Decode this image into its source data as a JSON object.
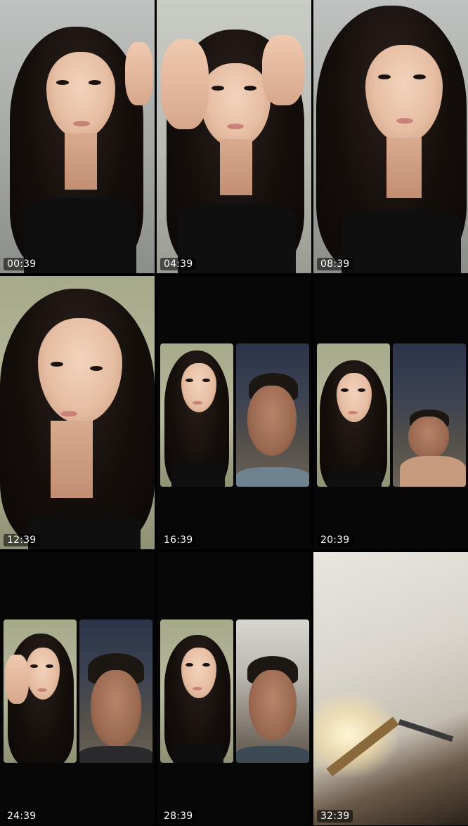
{
  "thumbnails": [
    {
      "timestamp": "00:39"
    },
    {
      "timestamp": "04:39"
    },
    {
      "timestamp": "08:39"
    },
    {
      "timestamp": "12:39"
    },
    {
      "timestamp": "16:39"
    },
    {
      "timestamp": "20:39"
    },
    {
      "timestamp": "24:39"
    },
    {
      "timestamp": "28:39"
    },
    {
      "timestamp": "32:39"
    }
  ],
  "colors": {
    "background": "#000000",
    "timestamp_text": "#ffffff"
  }
}
